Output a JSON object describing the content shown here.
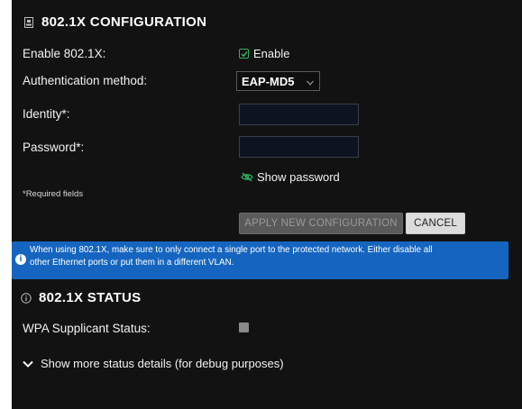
{
  "config_section": {
    "title": "802.1X CONFIGURATION",
    "enable_label": "Enable 802.1X:",
    "enable_checkbox_label": "Enable",
    "enable_checked": true,
    "auth_method_label": "Authentication method:",
    "auth_method_value": "EAP-MD5",
    "identity_label": "Identity*:",
    "identity_value": "",
    "password_label": "Password*:",
    "password_value": "",
    "show_password_label": "Show password",
    "required_note": "*Required fields",
    "apply_button": "APPLY NEW CONFIGURATION",
    "cancel_button": "CANCEL"
  },
  "info_banner": {
    "line1": "When using 802.1X, make sure to only connect a single port to the protected network. Either disable all",
    "line2": "other Ethernet ports or put them in a different VLAN."
  },
  "status_section": {
    "title": "802.1X STATUS",
    "supplicant_label": "WPA Supplicant Status:",
    "more_details_label": "Show more status details (for debug purposes)"
  },
  "colors": {
    "panel_bg": "#121212",
    "accent_green": "#2fb35e",
    "info_blue": "#1565c0",
    "status_gray": "#8a8a8a"
  }
}
